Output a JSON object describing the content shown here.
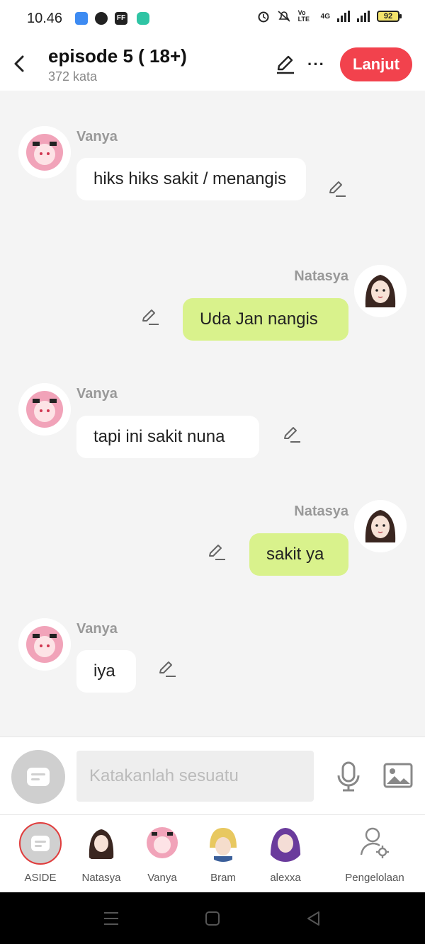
{
  "status_bar": {
    "time": "10.46",
    "app_icons": [
      "FF"
    ],
    "network": "4G",
    "volte": "Vo LTE",
    "battery": "92"
  },
  "header": {
    "title": "episode 5 ( 18+)",
    "word_count": "372 kata",
    "next_label": "Lanjut"
  },
  "messages": [
    {
      "sender": "Vanya",
      "text": "hiks hiks sakit / menangis",
      "side": "left"
    },
    {
      "sender": "Natasya",
      "text": "Uda Jan nangis",
      "side": "right"
    },
    {
      "sender": "Vanya",
      "text": "tapi ini sakit nuna",
      "side": "left"
    },
    {
      "sender": "Natasya",
      "text": "sakit ya",
      "side": "right"
    },
    {
      "sender": "Vanya",
      "text": "iya",
      "side": "left"
    }
  ],
  "composer": {
    "placeholder": "Katakanlah sesuatu"
  },
  "characters": [
    {
      "name": "ASIDE"
    },
    {
      "name": "Natasya"
    },
    {
      "name": "Vanya"
    },
    {
      "name": "Bram"
    },
    {
      "name": "alexxa"
    },
    {
      "name": "Pengelolaan"
    }
  ],
  "colors": {
    "accent": "#f2424d",
    "bubble_right": "#d9f28c",
    "bubble_left": "#ffffff",
    "background": "#f4f4f4"
  }
}
